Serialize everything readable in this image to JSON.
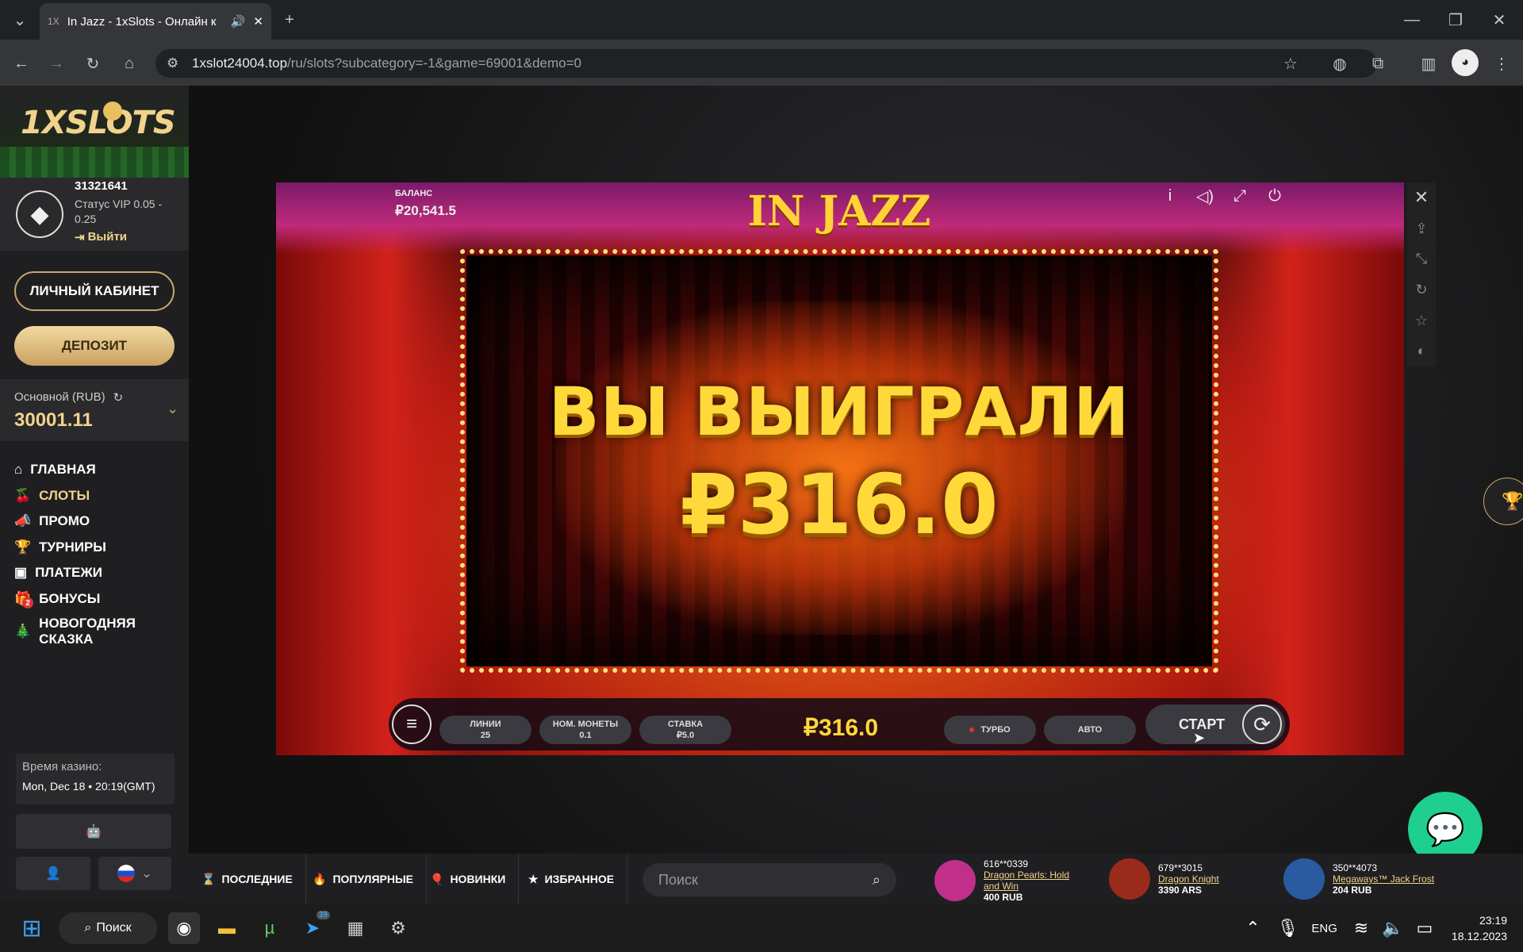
{
  "browser": {
    "tab_title": "In Jazz - 1xSlots - Онлайн к",
    "url_host": "1xslot24004.top",
    "url_path": "/ru/slots?subcategory=-1&game=69001&demo=0"
  },
  "sidebar": {
    "logo": "1XSLOTS",
    "user_id": "31321641",
    "vip_status": "Статус VIP 0.05 - 0.25",
    "logout": "Выйти",
    "cabinet_btn": "ЛИЧНЫЙ КАБИНЕТ",
    "deposit_btn": "ДЕПОЗИТ",
    "balance_label": "Основной (RUB)",
    "balance_value": "30001.11",
    "nav": [
      {
        "label": "ГЛАВНАЯ",
        "icon": "home-icon"
      },
      {
        "label": "СЛОТЫ",
        "icon": "cherry-icon",
        "active": true
      },
      {
        "label": "ПРОМО",
        "icon": "megaphone-icon"
      },
      {
        "label": "ТУРНИРЫ",
        "icon": "trophy-icon"
      },
      {
        "label": "ПЛАТЕЖИ",
        "icon": "wallet-icon"
      },
      {
        "label": "БОНУСЫ",
        "icon": "gift-icon",
        "badge": "2"
      },
      {
        "label": "НОВОГОДНЯЯ СКАЗКА",
        "icon": "tree-icon"
      }
    ],
    "casino_time_label": "Время казино:",
    "casino_time_value": "Mon, Dec 18 • 20:19(GMT)"
  },
  "game": {
    "title": "IN JAZZ",
    "balance_label": "БАЛАНС",
    "balance_value": "₽20,541.5",
    "win_text": "ВЫ ВЫИГРАЛИ",
    "win_amount": "₽316.0",
    "lines_label": "ЛИНИИ",
    "lines_value": "25",
    "coin_label": "НОМ. МОНЕТЫ",
    "coin_value": "0.1",
    "bet_label": "СТАВКА",
    "bet_value": "₽5.0",
    "bar_win": "₽316.0",
    "turbo": "ТУРБО",
    "auto": "АВТО",
    "start": "СТАРТ"
  },
  "bottom": {
    "cats": [
      "ПОСЛЕДНИЕ",
      "ПОПУЛЯРНЫЕ",
      "НОВИНКИ",
      "ИЗБРАННОЕ"
    ],
    "search_placeholder": "Поиск",
    "wins": [
      {
        "user": "616**0339",
        "game": "Dragon Pearls: Hold and Win",
        "amount": "400 RUB",
        "color": "#c0308a"
      },
      {
        "user": "679**3015",
        "game": "Dragon Knight",
        "amount": "3390 ARS",
        "color": "#9a2a1a"
      },
      {
        "user": "350**4073",
        "game": "Megaways™ Jack Frost",
        "amount": "204 RUB",
        "color": "#2a5aa0"
      }
    ]
  },
  "taskbar": {
    "search": "Поиск",
    "lang": "ENG",
    "time": "23:19",
    "date": "18.12.2023",
    "telegram_badge": "39"
  }
}
